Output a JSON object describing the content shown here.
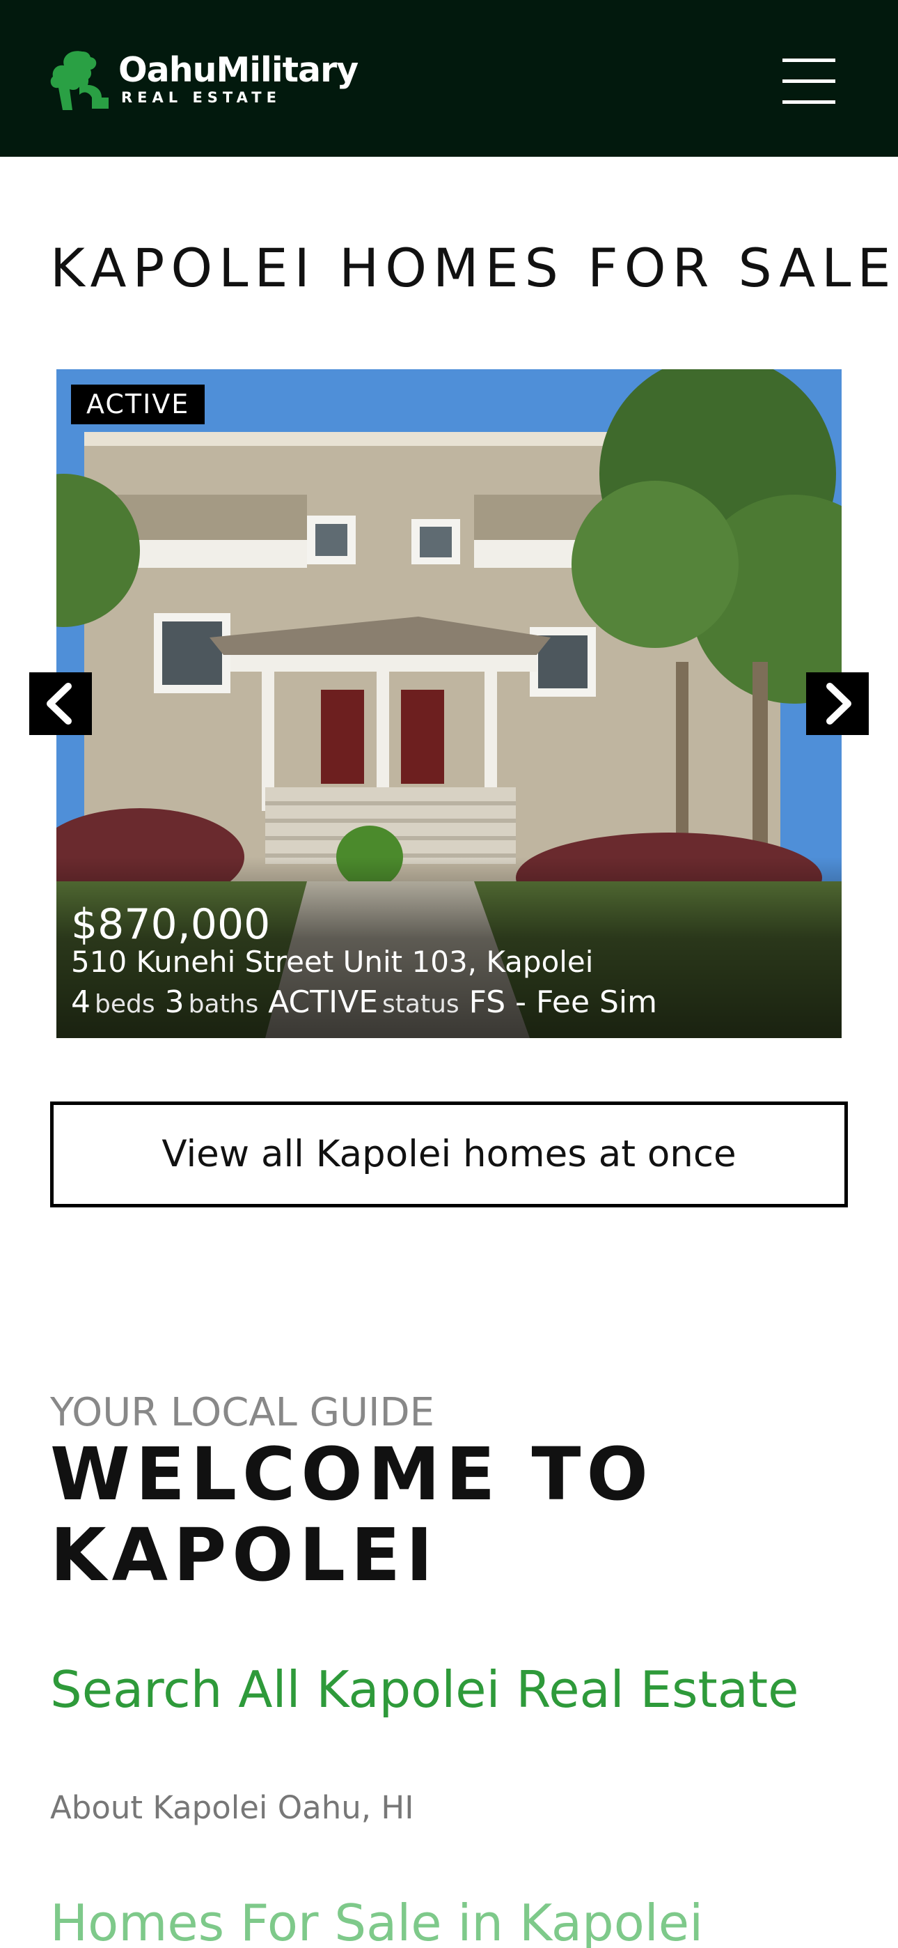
{
  "header": {
    "logo_name": "OahuMilitary",
    "logo_sub": "REAL ESTATE",
    "menu_icon": "hamburger-icon",
    "background_color": "#02190d"
  },
  "page": {
    "title": "KAPOLEI HOMES FOR SALE"
  },
  "listing": {
    "badge": "ACTIVE",
    "price": "$870,000",
    "address": "510 Kunehi Street Unit 103, Kapolei",
    "beds": "4",
    "beds_label": "beds",
    "baths": "3",
    "baths_label": "baths",
    "status": "ACTIVE",
    "status_label": "status",
    "tenure": "FS - Fee Sim",
    "prev_icon": "chevron-left-icon",
    "next_icon": "chevron-right-icon"
  },
  "view_all_label": "View all Kapolei homes at once",
  "guide": {
    "eyebrow": "YOUR LOCAL GUIDE",
    "heading": "WELCOME TO KAPOLEI",
    "search_link": "Search All Kapolei Real Estate",
    "about": "About Kapolei Oahu, HI",
    "homes_link": "Homes For Sale in Kapolei"
  },
  "colors": {
    "accent_green": "#2e9a3a",
    "logo_green": "#2aa044",
    "light_green": "#7ec98a"
  }
}
